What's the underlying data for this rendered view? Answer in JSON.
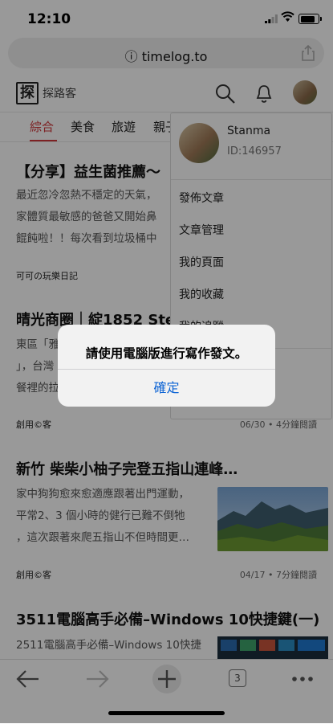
{
  "status": {
    "time": "12:10"
  },
  "browser": {
    "url": "timelog.to"
  },
  "site": {
    "logo_char": "探",
    "name": "探路客",
    "categories": [
      "綜合",
      "美食",
      "旅遊",
      "親子"
    ]
  },
  "articles": [
    {
      "title": "【分享】益生菌推薦～",
      "excerpt": [
        "最近忽冷忽熱不穩定的天氣，",
        "家體質最敏感的爸爸又開始鼻",
        "餛飩啦！！每次看到垃圾桶中"
      ],
      "author": "可可の玩樂日記"
    },
    {
      "title": "晴光商圈｜綻1852 Ste",
      "excerpt": [
        "東區「雅",
        "」，台灣",
        "餐裡的拉"
      ],
      "author": "創用©客",
      "meta": "06/30 • 4分鐘閱讀"
    },
    {
      "title": "新竹 柴柴小柚子完登五指山連峰…",
      "excerpt": [
        "家中狗狗愈來愈適應跟著出門運動，",
        "平常2、3 個小時的健行已難不倒牠",
        "，這次跟著來爬五指山不但時間更…"
      ],
      "author": "創用©客",
      "meta": "04/17 • 7分鐘閱讀"
    },
    {
      "title": "3511電腦高手必備–Windows 10快捷鍵(一)",
      "excerpt": [
        "2511電腦高手必備–Windows 10快捷"
      ]
    }
  ],
  "menu": {
    "user_name": "Stanma",
    "user_id": "ID:146957",
    "items": [
      "發佈文章",
      "文章管理",
      "我的頁面",
      "我的收藏",
      "我的追蹤"
    ]
  },
  "dialog": {
    "message": "請使用電腦版進行寫作發文。",
    "confirm": "確定"
  },
  "toolbar": {
    "tab_count": "3"
  },
  "colors": {
    "accent_red": "#d0373b",
    "ios_blue": "#0a62d4"
  }
}
